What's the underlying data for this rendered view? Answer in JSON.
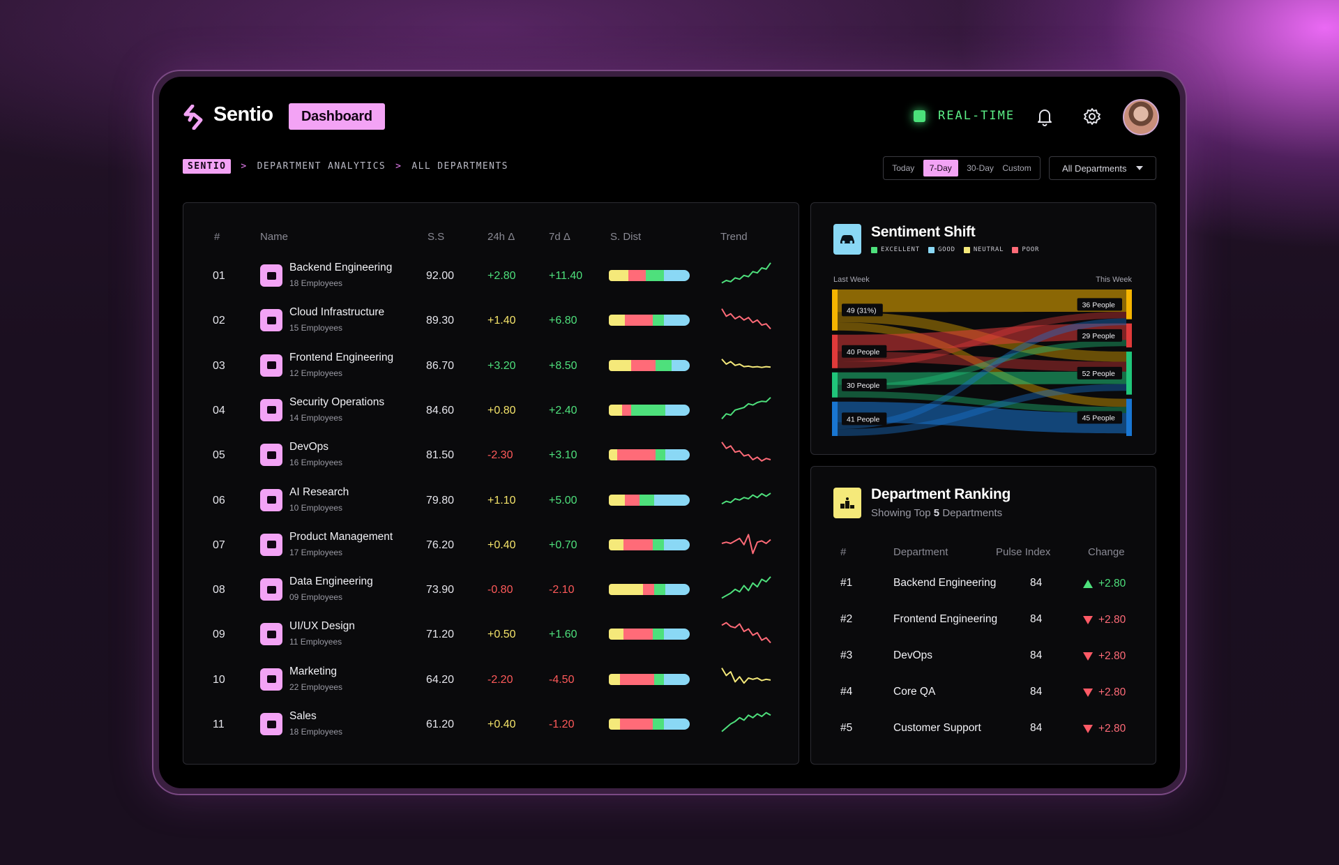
{
  "header": {
    "brand": "Sentio",
    "page_pill": "Dashboard",
    "status_label": "REAL-TIME",
    "icons": [
      "sentio-logo-icon",
      "bell-icon",
      "gear-icon",
      "user-avatar"
    ]
  },
  "breadcrumb": {
    "items": [
      "SENTIO",
      "DEPARTMENT ANALYTICS",
      "ALL DEPARTMENTS"
    ],
    "separator": ">"
  },
  "range_tabs": {
    "items": [
      "Today",
      "7-Day",
      "30-Day",
      "Custom"
    ],
    "selected": "7-Day"
  },
  "department_filter": {
    "value": "All Departments"
  },
  "colors": {
    "accent": "#f3a3f5",
    "excellent": "#4ee07c",
    "good": "#8ad8f5",
    "neutral": "#f5e97a",
    "poor": "#ff6b78"
  },
  "table": {
    "headers": [
      "#",
      "Name",
      "S.S",
      "24h Δ",
      "7d Δ",
      "S. Dist",
      "Trend"
    ],
    "rows": [
      {
        "num": "01",
        "name": "Backend Engineering",
        "employees": "18 Employees",
        "ss": "92.00",
        "d24": "+2.80",
        "d7": "+11.40",
        "icon": "server-icon",
        "dist": [
          0.24,
          0.22,
          0.22,
          0.32
        ],
        "trend": [
          0.15,
          0.25,
          0.2,
          0.35,
          0.3,
          0.45,
          0.4,
          0.6,
          0.55,
          0.75,
          0.7,
          0.95
        ],
        "trend_dir": "up"
      },
      {
        "num": "02",
        "name": "Cloud Infrastructure",
        "employees": "15 Employees",
        "ss": "89.30",
        "d24": "+1.40",
        "d7": "+6.80",
        "icon": "cloud-icon",
        "dist": [
          0.2,
          0.34,
          0.14,
          0.32
        ],
        "trend": [
          0.9,
          0.6,
          0.7,
          0.5,
          0.6,
          0.45,
          0.55,
          0.35,
          0.45,
          0.25,
          0.3,
          0.1
        ],
        "trend_dir": "down"
      },
      {
        "num": "03",
        "name": "Frontend Engineering",
        "employees": "12 Employees",
        "ss": "86.70",
        "d24": "+3.20",
        "d7": "+8.50",
        "icon": "laptop-icon",
        "dist": [
          0.28,
          0.3,
          0.2,
          0.22
        ],
        "trend": [
          0.7,
          0.5,
          0.6,
          0.45,
          0.5,
          0.4,
          0.42,
          0.38,
          0.4,
          0.37,
          0.4,
          0.38
        ],
        "trend_dir": "flat"
      },
      {
        "num": "04",
        "name": "Security Operations",
        "employees": "14 Employees",
        "ss": "84.60",
        "d24": "+0.80",
        "d7": "+2.40",
        "icon": "shield-icon",
        "dist": [
          0.16,
          0.12,
          0.42,
          0.3
        ],
        "trend": [
          0.1,
          0.3,
          0.25,
          0.45,
          0.5,
          0.55,
          0.7,
          0.65,
          0.75,
          0.8,
          0.78,
          0.95
        ],
        "trend_dir": "up"
      },
      {
        "num": "05",
        "name": "DevOps",
        "employees": "16 Employees",
        "ss": "81.50",
        "d24": "-2.30",
        "d7": "+3.10",
        "icon": "refresh-icon",
        "dist": [
          0.1,
          0.48,
          0.12,
          0.3
        ],
        "trend": [
          0.95,
          0.7,
          0.8,
          0.55,
          0.6,
          0.4,
          0.45,
          0.25,
          0.35,
          0.2,
          0.3,
          0.25
        ],
        "trend_dir": "down"
      },
      {
        "num": "06",
        "name": "AI Research",
        "employees": "10 Employees",
        "ss": "79.80",
        "d24": "+1.10",
        "d7": "+5.00",
        "icon": "sparkle-icon",
        "dist": [
          0.2,
          0.18,
          0.18,
          0.44
        ],
        "trend": [
          0.3,
          0.4,
          0.35,
          0.5,
          0.45,
          0.55,
          0.5,
          0.65,
          0.55,
          0.7,
          0.6,
          0.72
        ],
        "trend_dir": "up"
      },
      {
        "num": "07",
        "name": "Product Management",
        "employees": "17 Employees",
        "ss": "76.20",
        "d24": "+0.40",
        "d7": "+0.70",
        "icon": "grid-icon",
        "dist": [
          0.18,
          0.36,
          0.14,
          0.32
        ],
        "trend": [
          0.5,
          0.55,
          0.5,
          0.6,
          0.7,
          0.45,
          0.85,
          0.1,
          0.55,
          0.6,
          0.5,
          0.65
        ],
        "trend_dir": "mixed"
      },
      {
        "num": "08",
        "name": "Data Engineering",
        "employees": "09 Employees",
        "ss": "73.90",
        "d24": "-0.80",
        "d7": "-2.10",
        "icon": "database-icon",
        "dist": [
          0.42,
          0.14,
          0.14,
          0.3
        ],
        "trend": [
          0.1,
          0.2,
          0.3,
          0.45,
          0.35,
          0.6,
          0.4,
          0.7,
          0.55,
          0.85,
          0.75,
          0.95
        ],
        "trend_dir": "up"
      },
      {
        "num": "09",
        "name": "UI/UX Design",
        "employees": "11 Employees",
        "ss": "71.20",
        "d24": "+0.50",
        "d7": "+1.60",
        "icon": "pen-icon",
        "dist": [
          0.18,
          0.36,
          0.14,
          0.32
        ],
        "trend": [
          0.8,
          0.9,
          0.75,
          0.7,
          0.85,
          0.55,
          0.65,
          0.4,
          0.5,
          0.2,
          0.3,
          0.1
        ],
        "trend_dir": "down"
      },
      {
        "num": "10",
        "name": "Marketing",
        "employees": "22 Employees",
        "ss": "64.20",
        "d24": "-2.20",
        "d7": "-4.50",
        "icon": "megaphone-icon",
        "dist": [
          0.14,
          0.42,
          0.12,
          0.32
        ],
        "trend": [
          0.9,
          0.6,
          0.75,
          0.35,
          0.55,
          0.3,
          0.5,
          0.45,
          0.5,
          0.4,
          0.45,
          0.42
        ],
        "trend_dir": "flat"
      },
      {
        "num": "11",
        "name": "Sales",
        "employees": "18 Employees",
        "ss": "61.20",
        "d24": "+0.40",
        "d7": "-1.20",
        "icon": "bar-chart-icon",
        "dist": [
          0.14,
          0.4,
          0.14,
          0.32
        ],
        "trend": [
          0.15,
          0.3,
          0.45,
          0.55,
          0.7,
          0.6,
          0.8,
          0.7,
          0.85,
          0.75,
          0.9,
          0.8
        ],
        "trend_dir": "up"
      }
    ]
  },
  "sentiment_shift": {
    "title": "Sentiment Shift",
    "icon": "car-icon",
    "legend": [
      "EXCELLENT",
      "GOOD",
      "NEUTRAL",
      "POOR"
    ],
    "left_label": "Last Week",
    "right_label": "This Week",
    "left_nodes": [
      {
        "label": "49 (31%)",
        "value": 49,
        "color": "#f5b400"
      },
      {
        "label": "40 People",
        "value": 40,
        "color": "#e03a3a"
      },
      {
        "label": "30 People",
        "value": 30,
        "color": "#20c57a"
      },
      {
        "label": "41 People",
        "value": 41,
        "color": "#1976d2"
      }
    ],
    "right_nodes": [
      {
        "label": "36 People",
        "value": 36,
        "color": "#f5b400"
      },
      {
        "label": "29 People",
        "value": 29,
        "color": "#e03a3a"
      },
      {
        "label": "52 People",
        "value": 52,
        "color": "#20c57a"
      },
      {
        "label": "45 People",
        "value": 45,
        "color": "#1976d2"
      }
    ]
  },
  "ranking": {
    "title": "Department Ranking",
    "subtitle_prefix": "Showing Top",
    "subtitle_count": "5",
    "subtitle_suffix": "Departments",
    "icon": "podium-icon",
    "headers": [
      "#",
      "Department",
      "Pulse Index",
      "Change"
    ],
    "rows": [
      {
        "rank": "#1",
        "dept": "Backend Engineering",
        "pulse": "84",
        "change": "+2.80",
        "dir": "up"
      },
      {
        "rank": "#2",
        "dept": "Frontend Engineering",
        "pulse": "84",
        "change": "+2.80",
        "dir": "down"
      },
      {
        "rank": "#3",
        "dept": "DevOps",
        "pulse": "84",
        "change": "+2.80",
        "dir": "down"
      },
      {
        "rank": "#4",
        "dept": "Core QA",
        "pulse": "84",
        "change": "+2.80",
        "dir": "down"
      },
      {
        "rank": "#5",
        "dept": "Customer Support",
        "pulse": "84",
        "change": "+2.80",
        "dir": "down"
      }
    ]
  }
}
